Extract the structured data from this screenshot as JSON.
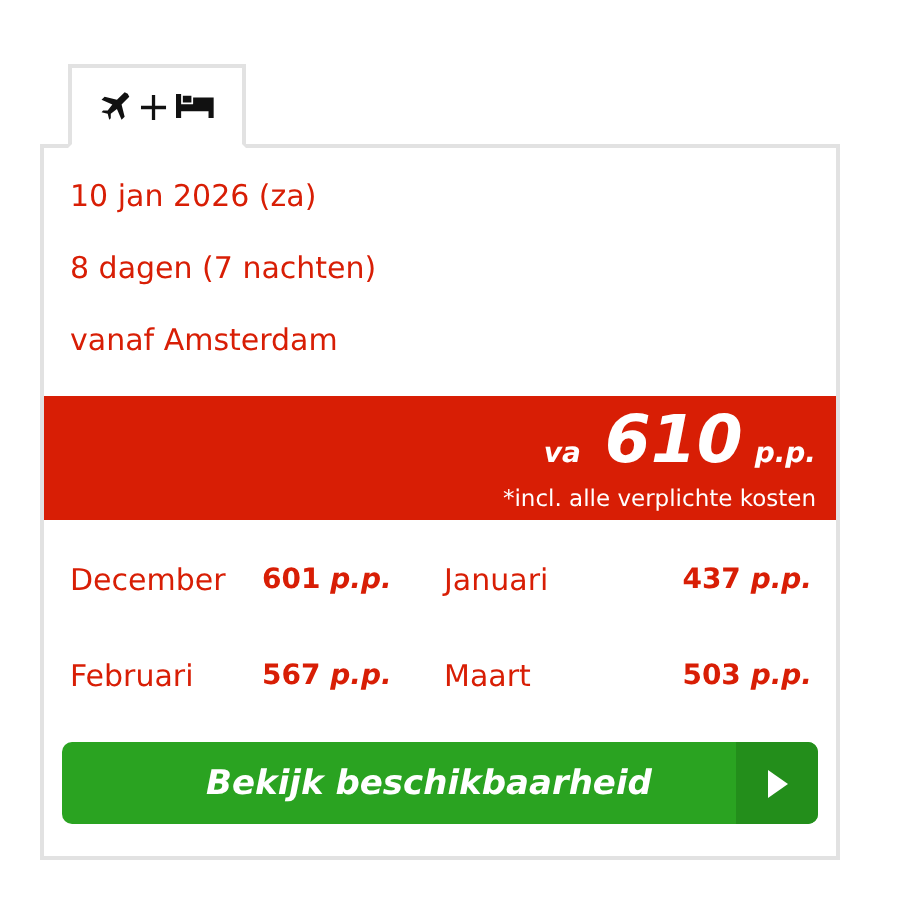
{
  "tabs": [
    {
      "label": "+",
      "selected": true
    }
  ],
  "details": [
    "10 jan 2026 (za)",
    "8 dagen (7 nachten)",
    "vanaf Amsterdam"
  ],
  "price": {
    "prefix": "va",
    "amount": "610",
    "unit": "p.p.",
    "note": "*incl. alle verplichte kosten"
  },
  "months": [
    {
      "name": "December",
      "price": "601",
      "unit": "p.p."
    },
    {
      "name": "Januari",
      "price": "437",
      "unit": "p.p."
    },
    {
      "name": "Februari",
      "price": "567",
      "unit": "p.p."
    },
    {
      "name": "Maart",
      "price": "503",
      "unit": "p.p."
    }
  ],
  "button": {
    "label": "Bekijk beschikbaarheid"
  }
}
